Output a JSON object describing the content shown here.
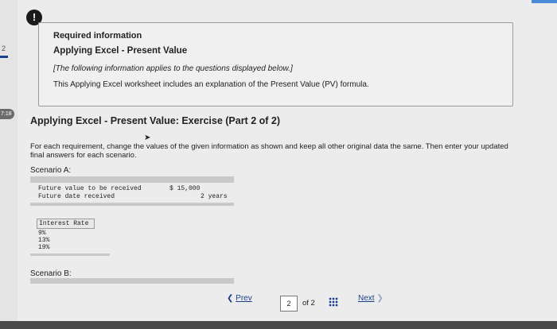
{
  "sidebar": {
    "question_number": "2",
    "timer": "7:18"
  },
  "alert": {
    "symbol": "!"
  },
  "info_box": {
    "label": "Required information",
    "title": "Applying Excel - Present Value",
    "note": "[The following information applies to the questions displayed below.]",
    "description": "This Applying Excel worksheet includes an explanation of the Present Value (PV) formula."
  },
  "exercise": {
    "heading": "Applying Excel - Present Value: Exercise (Part 2 of 2)",
    "instructions": "For each requirement, change the values of the given information as shown and keep all other original data the same. Then enter your updated final answers for each scenario.",
    "scenario_a": {
      "label": "Scenario A:",
      "future_value_label": "Future value to be received",
      "future_value": "$  15,000",
      "future_date_label": "Future date received",
      "future_date": "2  years",
      "rate_header": "Interest Rate",
      "rates": [
        "9%",
        "13%",
        "19%"
      ]
    },
    "scenario_b": {
      "label": "Scenario B:"
    }
  },
  "pagination": {
    "prev": "Prev",
    "current": "2",
    "of_text": "of 2",
    "next": "Next"
  },
  "colors": {
    "link": "#1a3f8a",
    "accent": "#4a8ad6"
  }
}
